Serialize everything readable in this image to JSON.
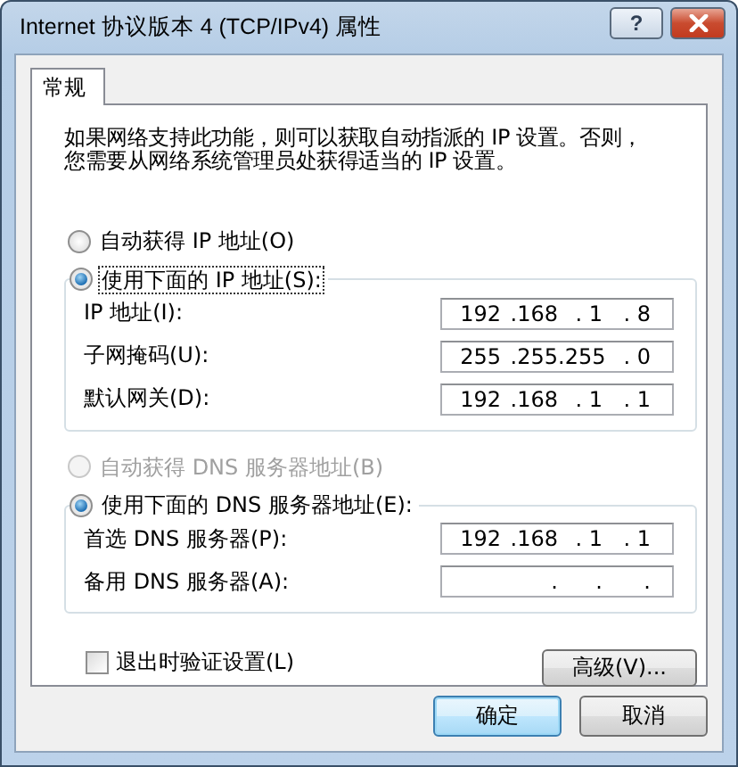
{
  "window": {
    "title": "Internet 协议版本 4 (TCP/IPv4) 属性",
    "help_button": "?"
  },
  "tabs": [
    {
      "label": "常规",
      "selected": true
    }
  ],
  "description": "如果网络支持此功能，则可以获取自动指派的 IP 设置。否则，您需要从网络系统管理员处获得适当的 IP 设置。",
  "ip_mode": [
    {
      "label": "自动获得 IP 地址(O)",
      "selected": false,
      "disabled": false,
      "focused": false
    },
    {
      "label": "使用下面的 IP 地址(S):",
      "selected": true,
      "disabled": false,
      "focused": true
    }
  ],
  "ip_fields": [
    {
      "label": "IP 地址(I):",
      "cells": [
        "192",
        ".168",
        ". 1",
        ". 8"
      ]
    },
    {
      "label": "子网掩码(U):",
      "cells": [
        "255",
        ".255",
        ".255",
        ". 0"
      ]
    },
    {
      "label": "默认网关(D):",
      "cells": [
        "192",
        ".168",
        ". 1",
        ". 1"
      ]
    }
  ],
  "dns_mode": [
    {
      "label": "自动获得 DNS 服务器地址(B)",
      "selected": false,
      "disabled": true,
      "focused": false
    },
    {
      "label": "使用下面的 DNS 服务器地址(E):",
      "selected": true,
      "disabled": false,
      "focused": false
    }
  ],
  "dns_fields": [
    {
      "label": "首选 DNS 服务器(P):",
      "cells": [
        "192",
        ".168",
        ". 1",
        ". 1"
      ]
    },
    {
      "label": "备用 DNS 服务器(A):",
      "cells": [
        ".",
        ".",
        "."
      ]
    }
  ],
  "validate": {
    "label": "退出时验证设置(L)",
    "checked": false
  },
  "advanced_button": "高级(V)...",
  "buttons": [
    {
      "label": "确定",
      "default": true
    },
    {
      "label": "取消",
      "default": false
    }
  ]
}
